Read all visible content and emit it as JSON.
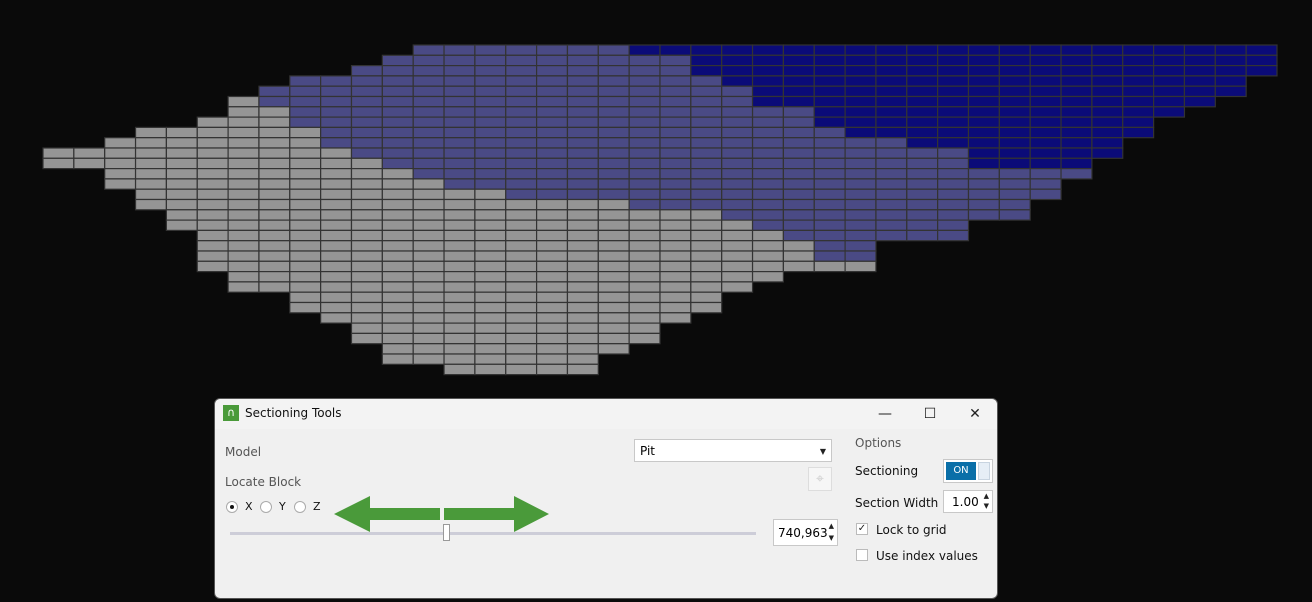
{
  "colors": {
    "grey": "#959595",
    "purple": "#4a4a85",
    "navy": "#0b0b78",
    "accent": "#0a6fa8",
    "arrow": "#4a9a3a"
  },
  "block_model": {
    "columns": 40,
    "rows": [
      [
        12,
        39,
        0,
        19
      ],
      [
        11,
        39,
        0,
        21
      ],
      [
        10,
        39,
        0,
        21
      ],
      [
        8,
        38,
        0,
        22
      ],
      [
        7,
        38,
        0,
        23
      ],
      [
        6,
        37,
        7,
        23
      ],
      [
        6,
        36,
        8,
        25
      ],
      [
        5,
        35,
        8,
        25
      ],
      [
        3,
        35,
        9,
        26
      ],
      [
        2,
        34,
        9,
        28
      ],
      [
        0,
        34,
        10,
        30
      ],
      [
        0,
        33,
        11,
        30
      ],
      [
        2,
        33,
        12,
        99
      ],
      [
        2,
        32,
        13,
        99
      ],
      [
        3,
        32,
        15,
        99
      ],
      [
        3,
        31,
        19,
        99
      ],
      [
        4,
        31,
        22,
        99
      ],
      [
        4,
        29,
        23,
        99
      ],
      [
        5,
        29,
        24,
        99
      ],
      [
        5,
        26,
        25,
        99
      ],
      [
        5,
        26,
        25,
        99
      ],
      [
        5,
        26,
        27,
        99
      ],
      [
        6,
        23,
        99,
        99
      ],
      [
        6,
        22,
        99,
        99
      ],
      [
        8,
        21,
        99,
        99
      ],
      [
        8,
        21,
        99,
        99
      ],
      [
        9,
        20,
        99,
        99
      ],
      [
        10,
        19,
        99,
        99
      ],
      [
        10,
        19,
        99,
        99
      ],
      [
        11,
        18,
        99,
        99
      ],
      [
        11,
        17,
        99,
        99
      ],
      [
        13,
        17,
        99,
        99
      ]
    ]
  },
  "dialog": {
    "title": "Sectioning Tools",
    "minimize": "—",
    "maximize": "☐",
    "close": "✕",
    "model_label": "Model",
    "model_value": "Pit",
    "locate_label": "Locate Block",
    "axes": [
      {
        "label": "X",
        "selected": true
      },
      {
        "label": "Y",
        "selected": false
      },
      {
        "label": "Z",
        "selected": false
      }
    ],
    "position_value": "740,963",
    "slider_fraction": 0.41,
    "options_label": "Options",
    "sectioning_label": "Sectioning",
    "sectioning_state": "ON",
    "section_width_label": "Section Width",
    "section_width_value": "1.00",
    "lock_to_grid_label": "Lock to grid",
    "lock_to_grid_checked": true,
    "use_index_label": "Use index values",
    "use_index_checked": false
  }
}
